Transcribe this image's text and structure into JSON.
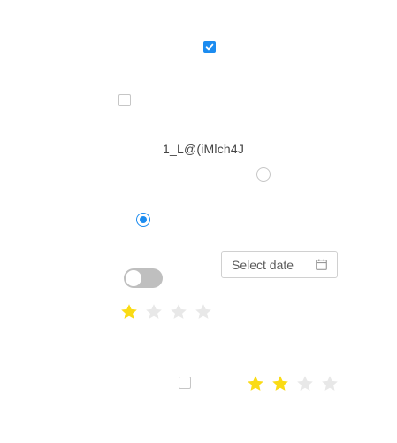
{
  "checkboxes": [
    {
      "label": "",
      "checked": true
    },
    {
      "label": "",
      "checked": false
    },
    {
      "label": "",
      "checked": false
    }
  ],
  "text": "1_L@(iMlch4J",
  "radios": [
    {
      "checked": false
    },
    {
      "checked": true
    }
  ],
  "date_picker": {
    "placeholder": "Select date",
    "icon": "calendar-icon"
  },
  "toggle": {
    "on": false
  },
  "ratings": [
    {
      "value": 1,
      "max": 4,
      "filled_color": "#fadb14",
      "empty_color": "#e8e8e8"
    },
    {
      "value": 2,
      "max": 4,
      "filled_color": "#fadb14",
      "empty_color": "#e8e8e8"
    }
  ],
  "colors": {
    "accent": "#1c8cf0",
    "border": "#c6c6c6",
    "toggle_off": "#bfbfbf"
  }
}
